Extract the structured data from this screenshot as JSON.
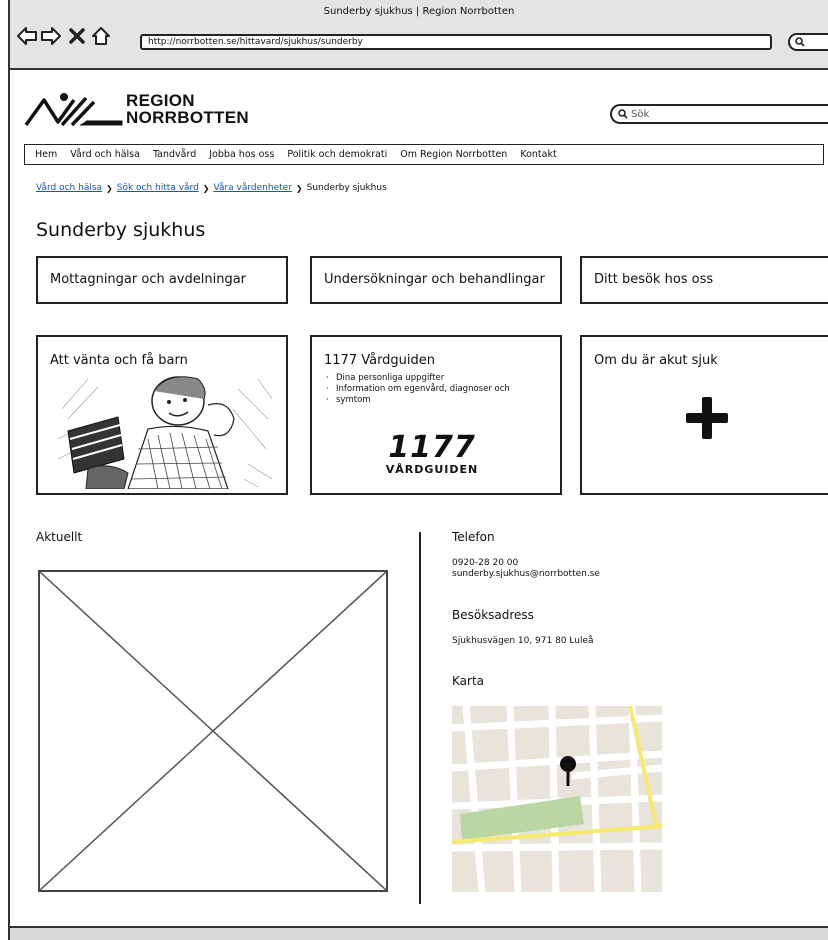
{
  "browser": {
    "window_title": "Sunderby sjukhus | Region Norrbotten",
    "url": "http://norrbotten.se/hittavard/sjukhus/sunderby"
  },
  "header": {
    "logo_line1": "REGION",
    "logo_line2": "NORRBOTTEN",
    "search_placeholder": "Sök"
  },
  "nav": {
    "items": [
      "Hem",
      "Vård och hälsa",
      "Tandvård",
      "Jobba hos oss",
      "Politik och demokrati",
      "Om Region Norrbotten",
      "Kontakt"
    ]
  },
  "breadcrumb": {
    "items": [
      "Vård och hälsa",
      "Sök och hitta vård",
      "Våra vårdenheter"
    ],
    "current": "Sunderby sjukhus"
  },
  "page": {
    "title": "Sunderby sjukhus"
  },
  "cards": {
    "c1": "Mottagningar och avdelningar",
    "c2": "Undersökningar och behandlingar",
    "c3": "Ditt besök hos oss",
    "c4": "Att vänta och få barn",
    "c5": {
      "title": "1177 Vårdguiden",
      "bullets": [
        "Dina personliga uppgifter",
        "Information om egenvård, diagnoser och",
        "symtom"
      ],
      "logo_num": "1177",
      "logo_label": "VÅRDGUIDEN"
    },
    "c6": "Om du är akut sjuk"
  },
  "news": {
    "title": "Aktuellt"
  },
  "contact": {
    "phone_title": "Telefon",
    "phone": "0920-28 20 00",
    "email": "sunderby.sjukhus@norrbotten.se",
    "address_title": "Besöksadress",
    "address": "Sjukhusvägen 10, 971 80 Luleå",
    "map_title": "Karta"
  },
  "colors": {
    "link": "#1a56a8",
    "map_park": "#b9d6a3",
    "map_road": "#f7e96b"
  }
}
